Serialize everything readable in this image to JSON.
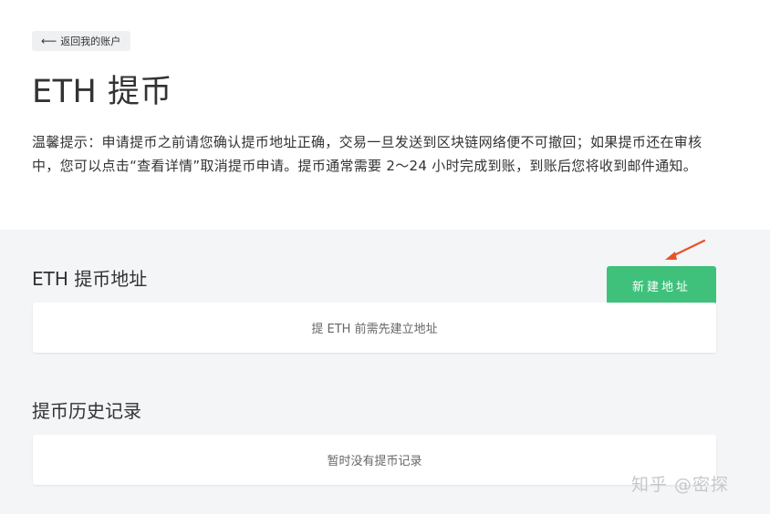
{
  "back_button": {
    "label": "返回我的账户",
    "icon": "arrow-left-icon"
  },
  "page_title": "ETH 提币",
  "notice": "温馨提示：申请提币之前请您确认提币地址正确，交易一旦发送到区块链网络便不可撤回；如果提币还在审核中，您可以点击“查看详情”取消提币申请。提币通常需要 2～24 小时完成到账，到账后您将收到邮件通知。",
  "address_section": {
    "title": "ETH 提币地址",
    "new_button_label": "新建地址",
    "empty_text": "提 ETH 前需先建立地址"
  },
  "history_section": {
    "title": "提币历史记录",
    "empty_text": "暂时没有提币记录"
  },
  "watermark": "知乎 @密探",
  "colors": {
    "accent_green": "#3fc17c",
    "annotation_arrow": "#e8532b",
    "lower_background": "#f4f5f7"
  }
}
